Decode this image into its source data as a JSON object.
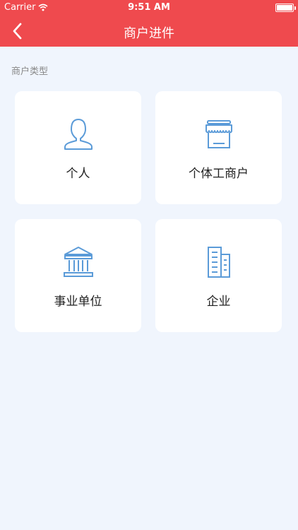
{
  "status_bar": {
    "carrier": "Carrier",
    "time": "9:51 AM"
  },
  "nav": {
    "title": "商户进件"
  },
  "section": {
    "label": "商户类型"
  },
  "merchant_types": [
    {
      "label": "个人",
      "icon": "person-icon"
    },
    {
      "label": "个体工商户",
      "icon": "storefront-icon"
    },
    {
      "label": "事业单位",
      "icon": "institution-icon"
    },
    {
      "label": "企业",
      "icon": "office-building-icon"
    }
  ],
  "colors": {
    "accent": "#ef4a4e",
    "icon": "#5b9bd8",
    "background": "#f0f5fd"
  }
}
